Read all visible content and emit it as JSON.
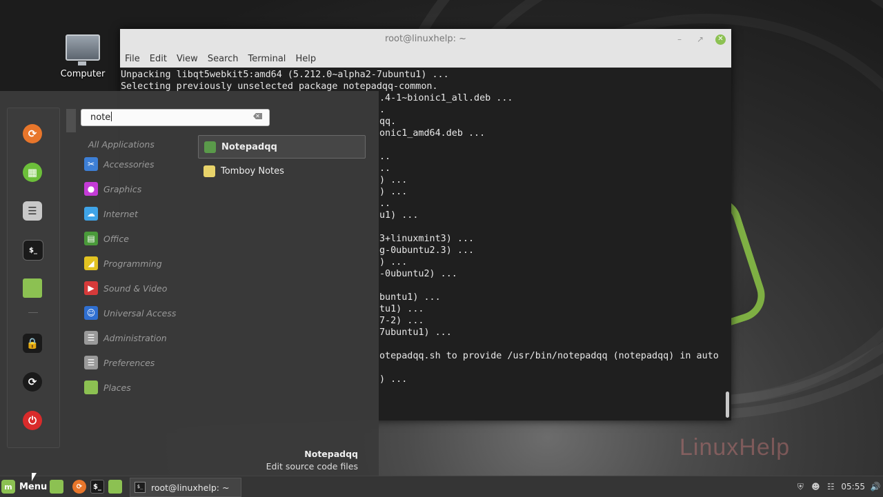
{
  "desktop": {
    "computer_label": "Computer",
    "watermark": "LinuxHelp"
  },
  "terminal": {
    "title": "root@linuxhelp: ~",
    "menu": [
      "File",
      "Edit",
      "View",
      "Search",
      "Terminal",
      "Help"
    ],
    "full_lines": [
      "Unpacking libqt5webkit5:amd64 (5.212.0~alpha2-7ubuntu1) ...",
      "Selecting previously unselected package notepadqq-common."
    ],
    "partial_lines": [
      ".4-1~bionic1_all.deb ...",
      ".",
      "qq.",
      "onic1_amd64.deb ...",
      "",
      "..",
      "..",
      ") ...",
      ") ...",
      "..",
      "u1) ...",
      "",
      "3+linuxmint3) ...",
      "g-0ubuntu2.3) ...",
      ") ...",
      "-0ubuntu2) ...",
      "",
      "buntu1) ...",
      "tu1) ...",
      "7-2) ...",
      "7ubuntu1) ...",
      "",
      "otepadqq.sh to provide /usr/bin/notepadqq (notepadqq) in auto",
      "",
      ") ..."
    ]
  },
  "menu": {
    "search_value": "note",
    "categories_header": "All Applications",
    "categories": [
      {
        "label": "Accessories",
        "icon": "scissors-icon",
        "color": "#3d7fd6"
      },
      {
        "label": "Graphics",
        "icon": "palette-icon",
        "color": "#c43bd6"
      },
      {
        "label": "Internet",
        "icon": "cloud-icon",
        "color": "#3fa4e8"
      },
      {
        "label": "Office",
        "icon": "document-icon",
        "color": "#4a9a3a"
      },
      {
        "label": "Programming",
        "icon": "ide-icon",
        "color": "#e2c321"
      },
      {
        "label": "Sound & Video",
        "icon": "play-icon",
        "color": "#d63a3a"
      },
      {
        "label": "Universal Access",
        "icon": "accessibility-icon",
        "color": "#2f6fd1"
      },
      {
        "label": "Administration",
        "icon": "admin-icon",
        "color": "#9a9a9a"
      },
      {
        "label": "Preferences",
        "icon": "preferences-icon",
        "color": "#9a9a9a"
      },
      {
        "label": "Places",
        "icon": "folder-icon",
        "color": "#8cc152"
      }
    ],
    "results": [
      {
        "label": "Notepadqq",
        "icon": "notepadqq-icon",
        "color": "#5a9a4a"
      },
      {
        "label": "Tomboy Notes",
        "icon": "tomboy-icon",
        "color": "#e8d36a"
      }
    ],
    "selected_app_name": "Notepadqq",
    "selected_app_desc": "Edit source code files"
  },
  "taskbar": {
    "menu_label": "Menu",
    "task_window": "root@linuxhelp: ~",
    "clock": "05:55"
  }
}
